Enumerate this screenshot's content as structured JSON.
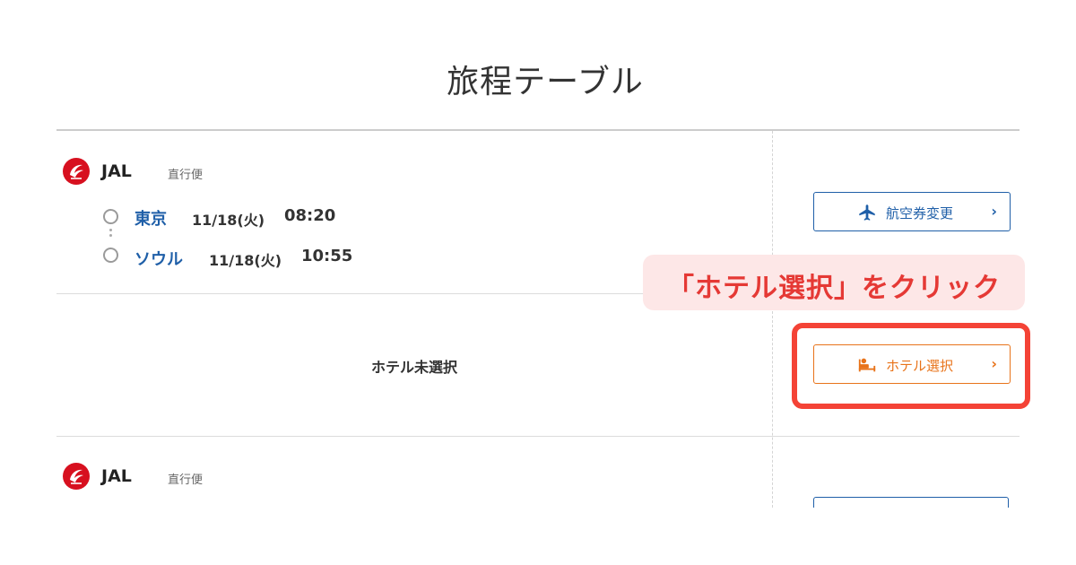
{
  "page": {
    "title": "旅程テーブル"
  },
  "flights": [
    {
      "airline": "JAL",
      "type": "直行便",
      "origin": {
        "city": "東京",
        "date": "11/18(火)",
        "time": "08:20"
      },
      "destination": {
        "city": "ソウル",
        "date": "11/18(火)",
        "time": "10:55"
      },
      "button": {
        "label": "航空券変更",
        "chevron": "›",
        "icon": "airplane-icon"
      }
    },
    {
      "airline": "JAL",
      "type": "直行便"
    }
  ],
  "hotel": {
    "status": "ホテル未選択",
    "button": {
      "label": "ホテル選択",
      "chevron": "›",
      "icon": "hotel-bed-icon"
    }
  },
  "annotation": {
    "callout": "「ホテル選択」をクリック",
    "color": "#e53935"
  },
  "colors": {
    "link_blue": "#1f5fa8",
    "hotel_orange": "#e8731a",
    "jal_red": "#d7101f"
  }
}
